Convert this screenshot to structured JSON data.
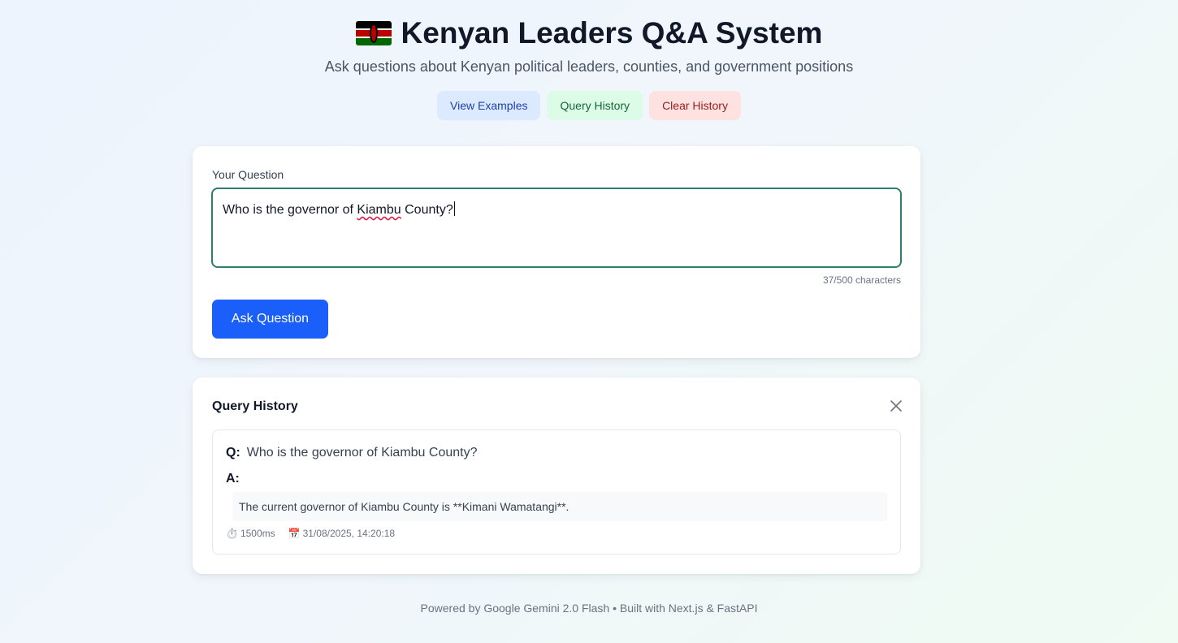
{
  "header": {
    "title": "Kenyan Leaders Q&A System",
    "flag_icon": "kenya-flag-icon",
    "subtitle": "Ask questions about Kenyan political leaders, counties, and government positions"
  },
  "actions": {
    "view_examples": "View Examples",
    "query_history": "Query History",
    "clear_history": "Clear History"
  },
  "ask": {
    "label": "Your Question",
    "value_prefix": "Who is the governor of ",
    "value_misspelled": "Kiambu",
    "value_suffix": " County?",
    "counter": "37/500 characters",
    "submit_label": "Ask Question"
  },
  "history": {
    "title": "Query History",
    "close_icon": "close-icon",
    "entries": [
      {
        "q_label": "Q:",
        "question": "Who is the governor of Kiambu County?",
        "a_label": "A:",
        "answer": "The current governor of Kiambu County is **Kimani Wamatangi**.",
        "duration": "1500ms",
        "timestamp": "31/08/2025, 14:20:18"
      }
    ]
  },
  "footer": {
    "text": "Powered by Google Gemini 2.0 Flash • Built with Next.js & FastAPI"
  },
  "colors": {
    "primary": "#1a5ffa",
    "focus_border": "#2e7d6f",
    "blue_pill_bg": "#dbeafe",
    "green_pill_bg": "#dcfce7",
    "red_pill_bg": "#fee2e2"
  }
}
